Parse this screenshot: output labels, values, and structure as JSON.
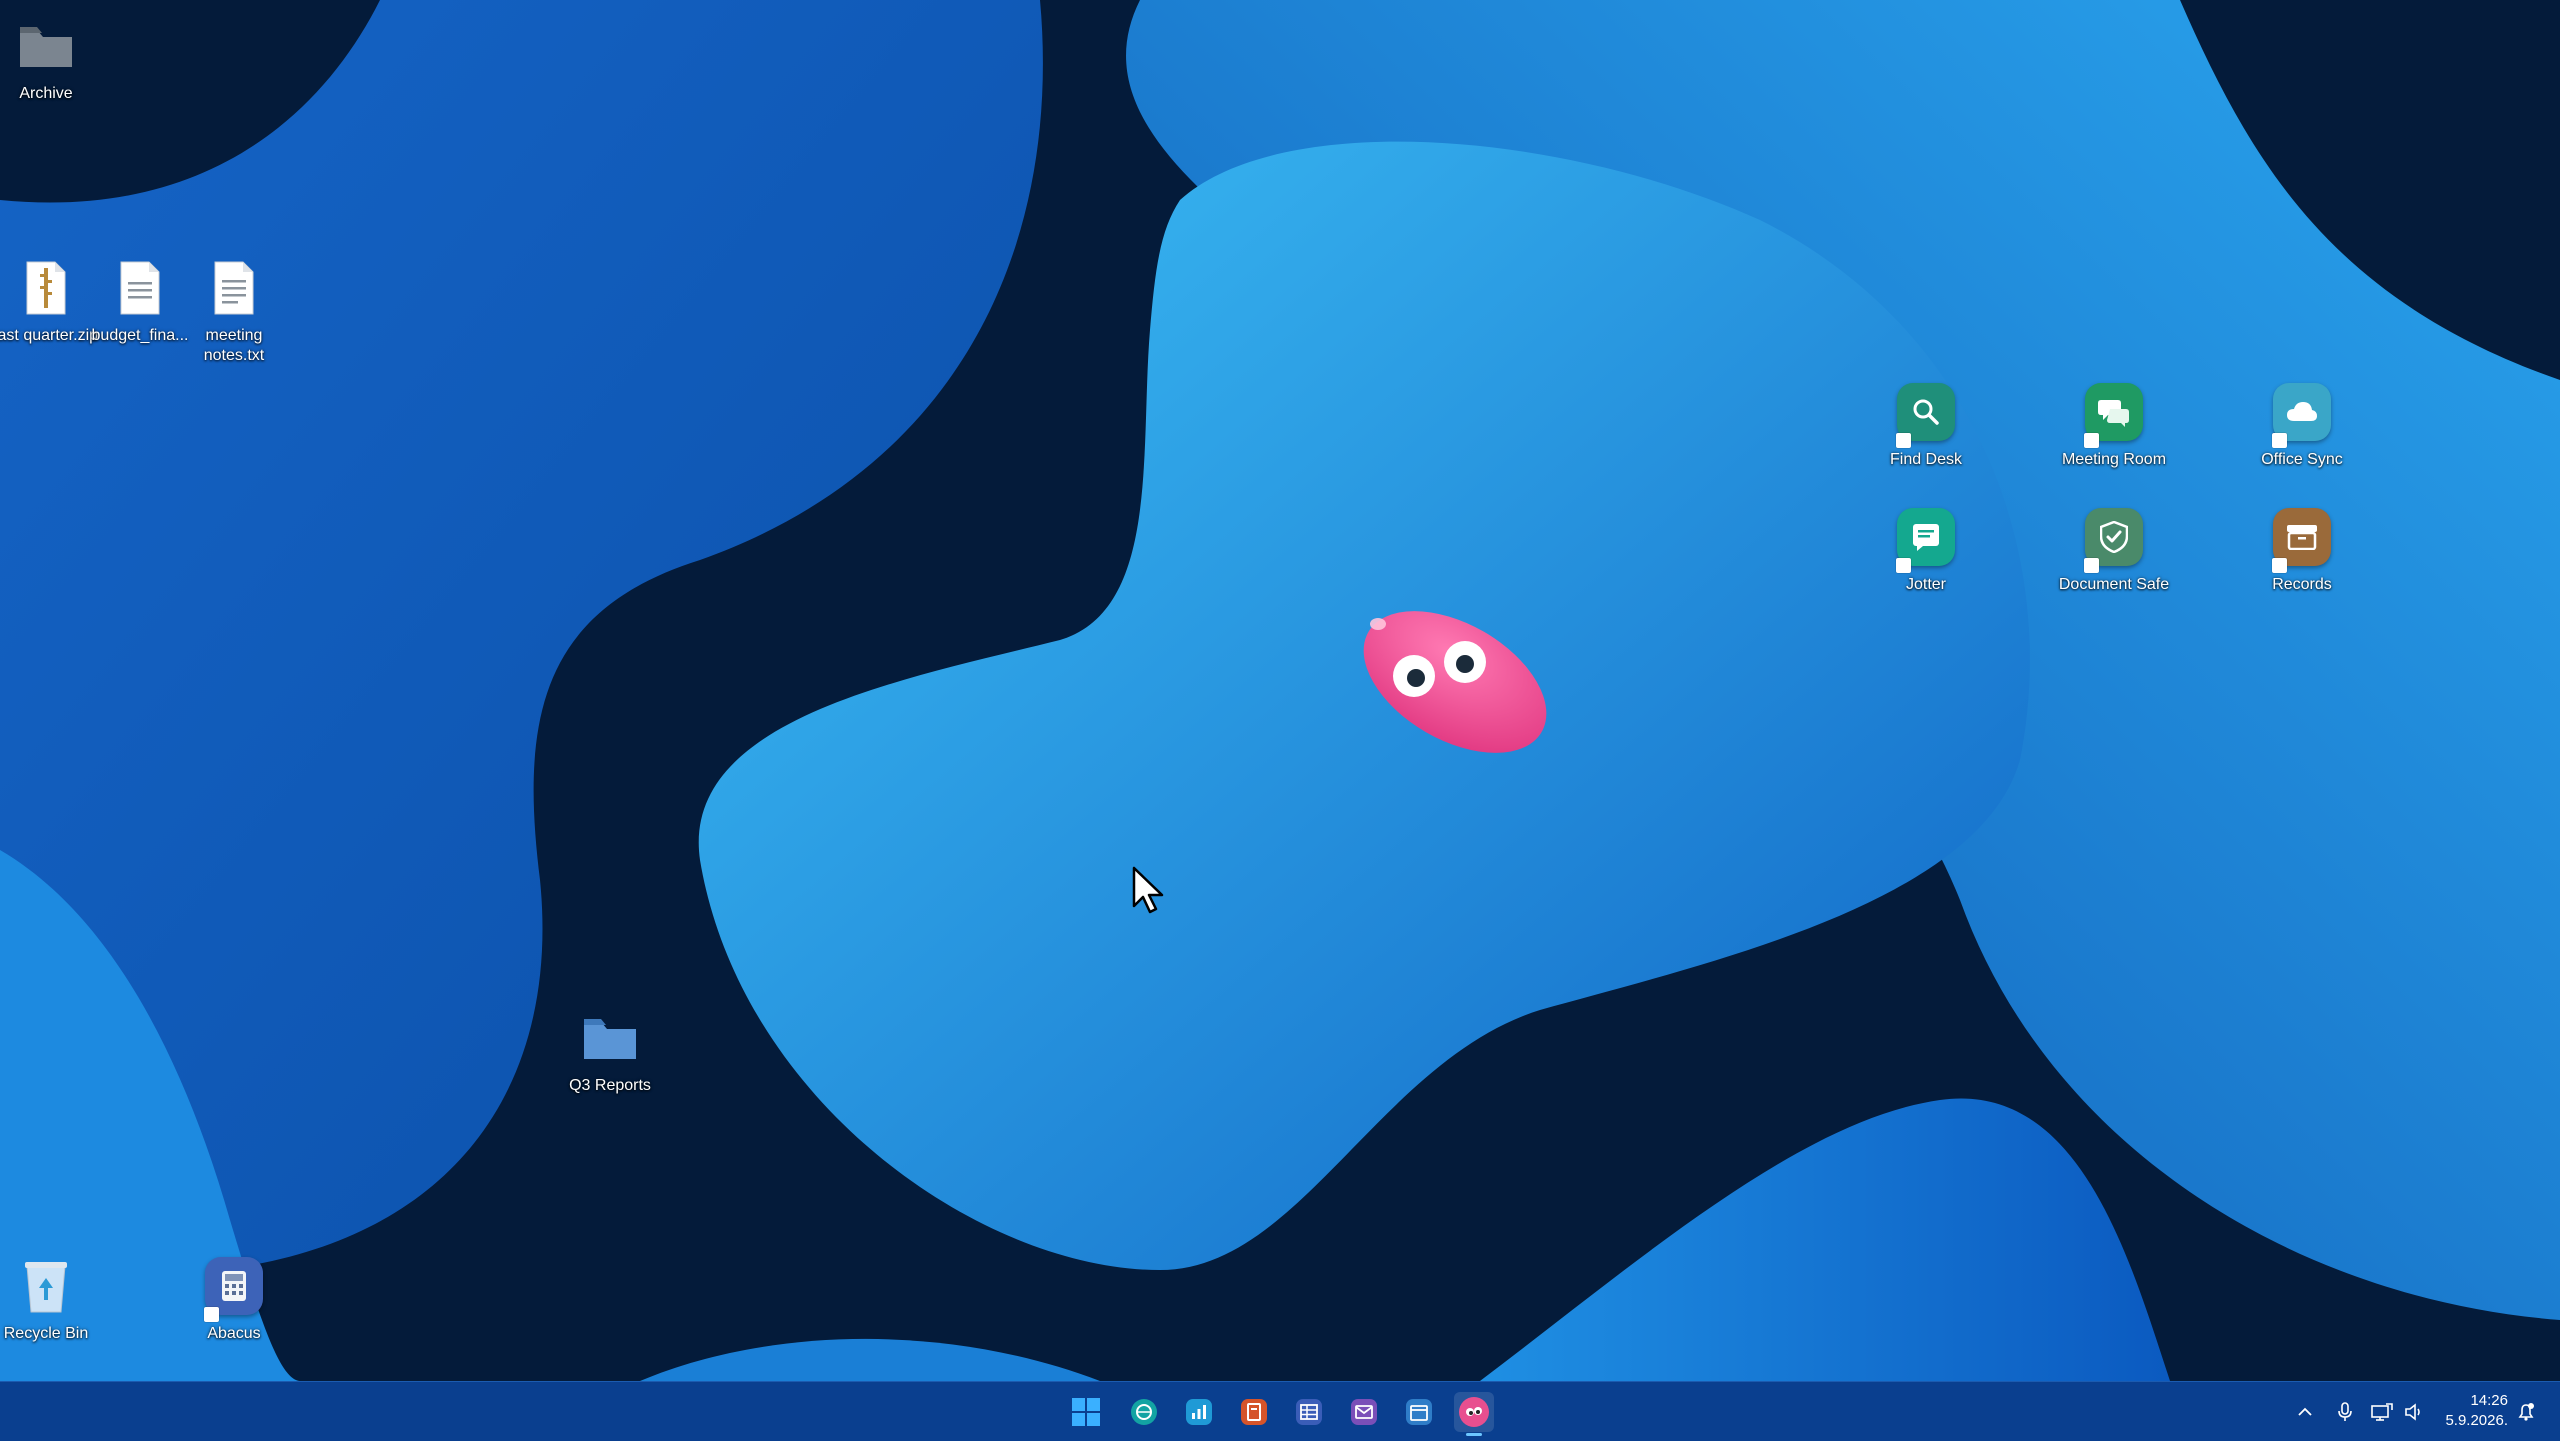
{
  "desktop": {
    "icons_left": [
      {
        "label": "Archive",
        "icon": "folder-icon"
      },
      {
        "label": "last quarter.zip",
        "icon": "zip-file-icon"
      },
      {
        "label": "budget_fina...",
        "icon": "document-icon"
      },
      {
        "label": "meeting notes.txt",
        "icon": "text-file-icon"
      },
      {
        "label": "Q3 Reports",
        "icon": "folder-icon"
      },
      {
        "label": "Recycle Bin",
        "icon": "recycle-bin-icon"
      },
      {
        "label": "Abacus",
        "icon": "calculator-icon"
      }
    ],
    "icons_right": [
      {
        "label": "Find Desk",
        "icon": "search-icon",
        "color": "#1f8f7a"
      },
      {
        "label": "Meeting Room",
        "icon": "chat-icon",
        "color": "#1f9a63"
      },
      {
        "label": "Office Sync",
        "icon": "cloud-icon",
        "color": "#3aa6c8"
      },
      {
        "label": "Jotter",
        "icon": "note-icon",
        "color": "#14a88f"
      },
      {
        "label": "Document Safe",
        "icon": "shield-icon",
        "color": "#4a8a6a"
      },
      {
        "label": "Records",
        "icon": "archive-box-icon",
        "color": "#9a6a3a"
      }
    ]
  },
  "taskbar": {
    "apps": [
      {
        "name": "start-button",
        "color": "#3ab0ff"
      },
      {
        "name": "browser",
        "color": "#13a3a3"
      },
      {
        "name": "charts",
        "color": "#1f9ad6"
      },
      {
        "name": "slides",
        "color": "#d5542a"
      },
      {
        "name": "sheets",
        "color": "#3a5db8"
      },
      {
        "name": "mail",
        "color": "#7a4fb8"
      },
      {
        "name": "calendar",
        "color": "#2f7dc8"
      },
      {
        "name": "blob-app",
        "color": "#e84f8f"
      }
    ],
    "time": "14:26",
    "date": "5.9.2026."
  },
  "colors": {
    "accent": "#0a3f8f",
    "wallpaper_dark": "#041b3a",
    "wallpaper_light": "#2fa6ee",
    "blob_pink": "#ec4d8c"
  }
}
